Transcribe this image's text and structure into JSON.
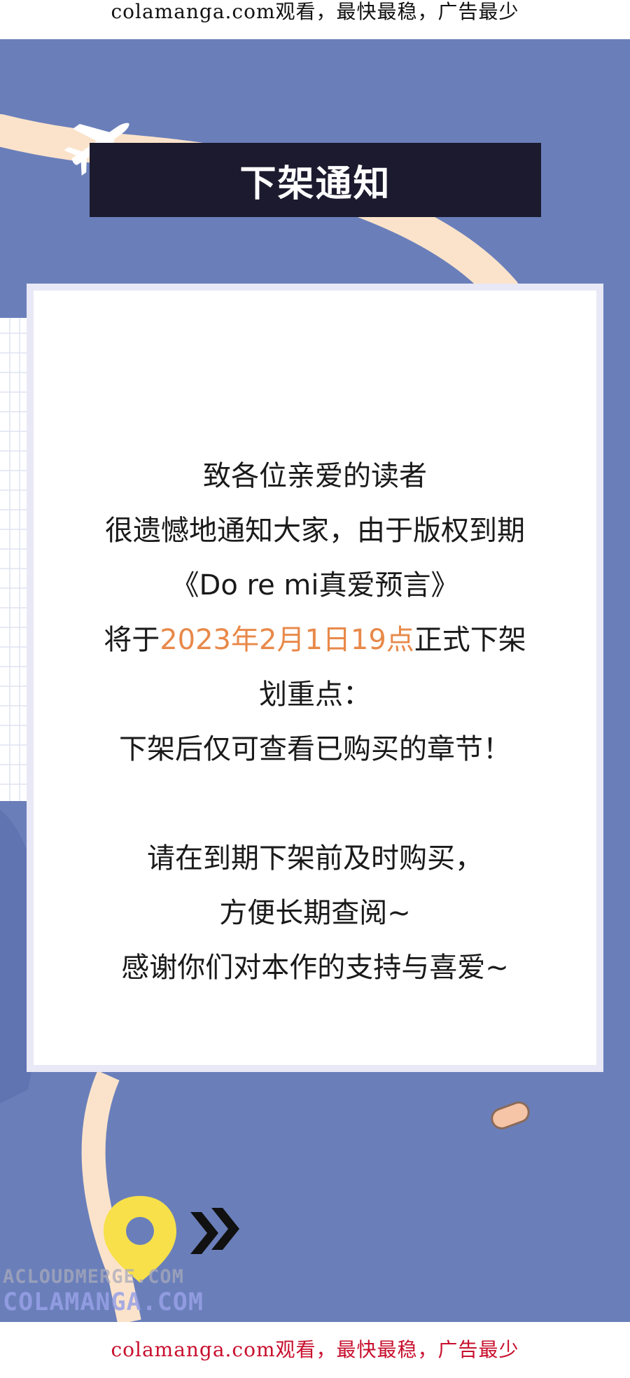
{
  "top_banner": {
    "text": "colamanga.com观看，最快最稳，广告最少"
  },
  "notice": {
    "title": "下架通知",
    "line_greeting": "致各位亲爱的读者",
    "line_apology": "很遗憾地通知大家，由于版权到期",
    "line_work_title": "《Do re mi真爱预言》",
    "line_removal_prefix": "将于",
    "line_removal_date": "2023年2月1日19点",
    "line_removal_suffix": "正式下架",
    "line_key_point": "划重点：",
    "line_key_detail": "下架后仅可查看已购买的章节！",
    "line_purchase": "请在到期下架前及时购买，",
    "line_convenience": "方便长期查阅~",
    "line_thanks": "感谢你们对本作的支持与喜爱~"
  },
  "watermark": {
    "line1": "ACLOUDMERGE.COM",
    "line2": "COLAMANGA.COM"
  },
  "bottom_banner": {
    "text": "colamanga.com观看，最快最稳，广告最少"
  },
  "colors": {
    "background_blue": "#6a7fba",
    "title_banner": "#1c1a2e",
    "cream_stripe": "#fbe3cb",
    "highlight_orange": "#e8894a",
    "capsule_yellow": "#f8d86a",
    "capsule_peach": "#f6c4a6",
    "ad_red": "#c8102e"
  },
  "icons": [
    "airplane-icon",
    "location-pin-icon",
    "double-chevron-icon",
    "capsule-decoration"
  ]
}
